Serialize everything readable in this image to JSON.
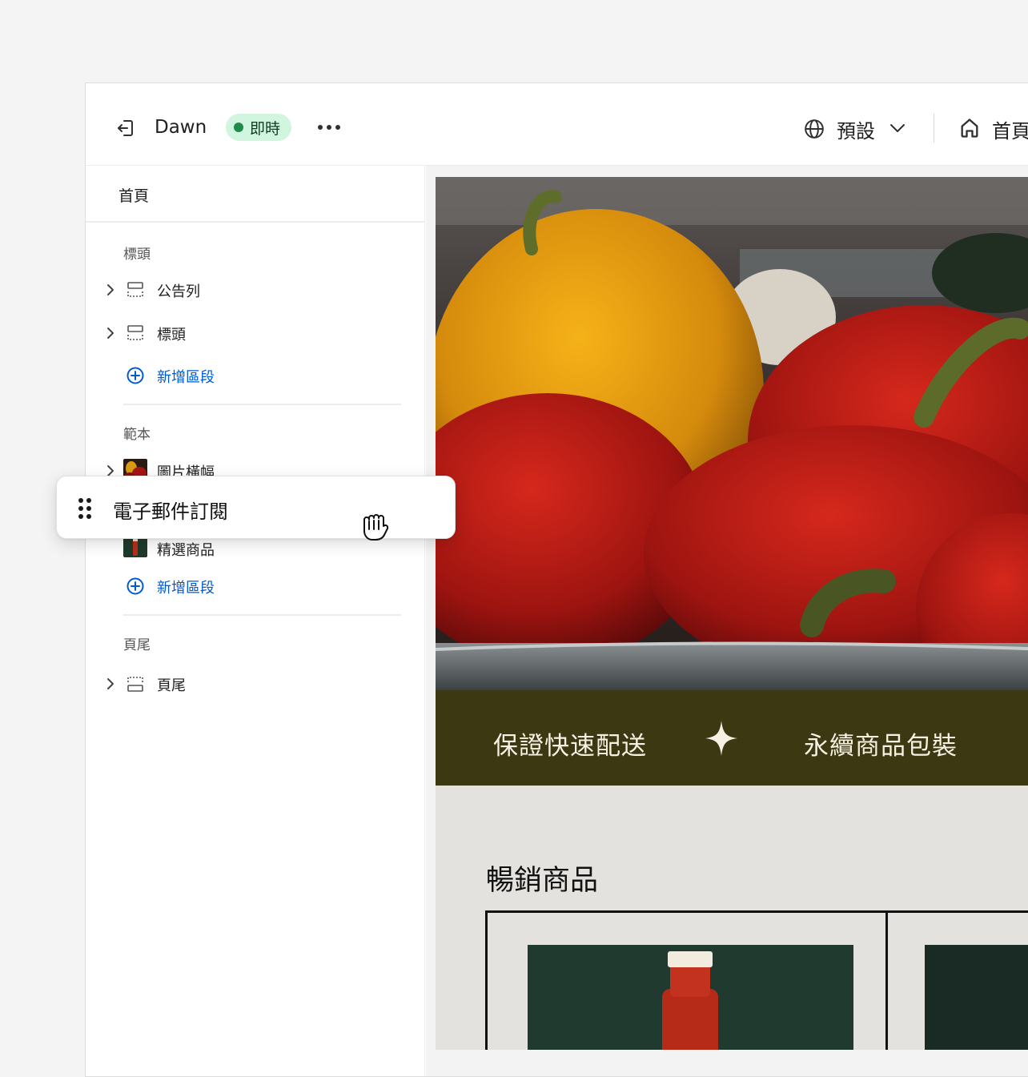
{
  "topbar": {
    "store_name": "Dawn",
    "status_badge": "即時",
    "language_label": "預設",
    "page_label": "首頁"
  },
  "sidebar": {
    "title": "首頁",
    "groups": [
      {
        "title": "標頭",
        "items": [
          {
            "label": "公告列",
            "icon": "section-icon"
          },
          {
            "label": "標頭",
            "icon": "section-icon"
          }
        ],
        "add_label": "新增區段"
      },
      {
        "title": "範本",
        "items": [
          {
            "label": "圖片橫幅",
            "icon": "image-thumbnail"
          },
          {
            "label": "精選商品",
            "icon": "product-thumbnail"
          }
        ],
        "add_label": "新增區段"
      },
      {
        "title": "頁尾",
        "items": [
          {
            "label": "頁尾",
            "icon": "footer-section-icon"
          }
        ]
      }
    ]
  },
  "drag_card": {
    "label": "電子郵件訂閱"
  },
  "preview": {
    "marquee_items": [
      "保證快速配送",
      "永續商品包裝"
    ],
    "featured_title": "暢銷商品"
  },
  "colors": {
    "live_badge_bg": "#d2f5df",
    "live_dot": "#1f8a4c",
    "link_blue": "#005bd3",
    "marquee_bg": "#3b3812",
    "products_bg": "#e3e2df"
  }
}
